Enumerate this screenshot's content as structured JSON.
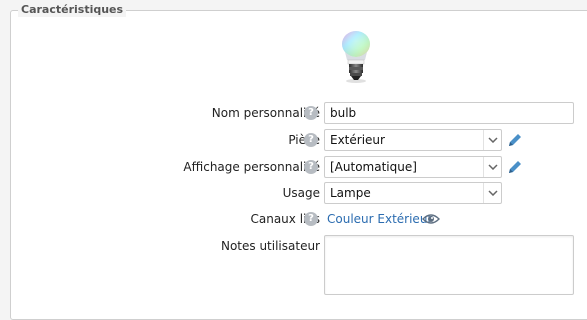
{
  "section": {
    "title": "Caractéristiques"
  },
  "device": {
    "icon": "rgb-bulb-icon"
  },
  "fields": {
    "name": {
      "label": "Nom personnalisé",
      "value": "bulb"
    },
    "room": {
      "label": "Pièce",
      "value": "Extérieur"
    },
    "display": {
      "label": "Affichage personnalisé",
      "value": "[Automatique]"
    },
    "usage": {
      "label": "Usage",
      "value": "Lampe"
    },
    "channels": {
      "label": "Canaux liés",
      "link": "Couleur Extérieur"
    },
    "notes": {
      "label": "Notes utilisateur",
      "value": ""
    }
  },
  "help_glyph": "?",
  "colors": {
    "accent_link": "#2b6cb0",
    "pencil": "#4a90c8"
  }
}
